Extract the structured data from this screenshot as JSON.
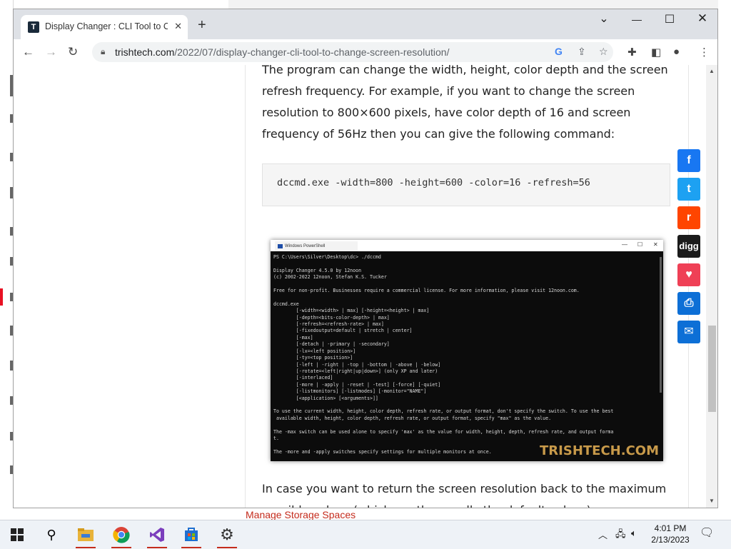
{
  "browser": {
    "tab_title": "Display Changer : CLI Tool to Change Screen Resolution",
    "tab_favicon": "T",
    "url_domain": "trishtech.com",
    "url_path": "/2022/07/display-changer-cli-tool-to-change-screen-resolution/"
  },
  "article": {
    "paragraph1": "The program can change the width, height, color depth and the screen refresh frequency. For example, if you want to change the screen resolution to 800×600 pixels, have color depth of 16 and screen frequency of 56Hz then you can give the following command:",
    "code": "dccmd.exe -width=800 -height=600 -color=16 -refresh=56",
    "paragraph2": "In case you want to return the screen resolution back to the maximum possible values (which are the usually the default values) ..."
  },
  "screenshot": {
    "window_title": "Windows PowerShell",
    "console_text": "PS C:\\Users\\Silver\\Desktop\\dc> ./dccmd\n\nDisplay Changer 4.5.0 by 12noon\n(c) 2002-2022 12noon, Stefan K.S. Tucker\n\nFree for non-profit. Businesses require a commercial license. For more information, please visit 12noon.com.\n\ndccmd.exe\n        [-width=<width> | max] [-height=<height> | max]\n        [-depth=<bits-color-depth> | max]\n        [-refresh=<refresh-rate> | max]\n        [-fixedoutput=default | stretch | center]\n        [-max]\n        [-detach | -primary | -secondary]\n        [-lx=<left position>]\n        [-ty=<top position>]\n        [-left | -right | -top | -bottom | -above | -below]\n        [-rotate=<left|right|up|down>] (only XP and later)\n        [-interlaced]\n        [-more | -apply | -reset | -test] [-force] [-quiet]\n        [-listmonitors] [-listmodes] [-monitor=\"NAME\"]\n        [<application> [<arguments>]]\n\nTo use the current width, height, color depth, refresh rate, or output format, don't specify the switch. To use the best\n available width, height, color depth, refresh rate, or output format, specify \"max\" as the value.\n\nThe -max switch can be used alone to specify 'max' as the value for width, height, depth, refresh rate, and output forma\nt.\n\nThe -more and -apply switches specify settings for multiple monitors at once.",
    "watermark": "TRISHTECH.COM"
  },
  "share_buttons": [
    {
      "name": "facebook",
      "glyph": "f",
      "color": "#1877f2"
    },
    {
      "name": "twitter",
      "glyph": "t",
      "color": "#1da1f2"
    },
    {
      "name": "reddit",
      "glyph": "r",
      "color": "#ff4500"
    },
    {
      "name": "digg",
      "glyph": "digg",
      "color": "#1b1b1b"
    },
    {
      "name": "pocket",
      "glyph": "♥",
      "color": "#ef4056"
    },
    {
      "name": "print",
      "glyph": "⎙",
      "color": "#0d6fd6"
    },
    {
      "name": "email",
      "glyph": "✉",
      "color": "#0d6fd6"
    }
  ],
  "background_window": {
    "link": "Manage Storage Spaces"
  },
  "taskbar": {
    "time": "4:01 PM",
    "date": "2/13/2023"
  }
}
